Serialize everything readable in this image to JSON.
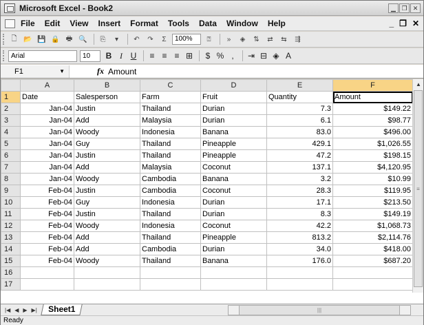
{
  "window": {
    "title": "Microsoft Excel - Book2"
  },
  "menu": [
    "File",
    "Edit",
    "View",
    "Insert",
    "Format",
    "Tools",
    "Data",
    "Window",
    "Help"
  ],
  "toolbar": {
    "zoom": "100%",
    "sum_label": "Σ"
  },
  "format_toolbar": {
    "font": "Arial",
    "size": "10",
    "currency": "$",
    "percent": "%"
  },
  "formula_bar": {
    "cell_ref": "F1",
    "fx": "fx",
    "value": "Amount"
  },
  "columns": [
    "A",
    "B",
    "C",
    "D",
    "E",
    "F"
  ],
  "header_row": [
    "Date",
    "Salesperson",
    "Farm",
    "Fruit",
    "Quantity",
    "Amount"
  ],
  "rows": [
    [
      "Jan-04",
      "Justin",
      "Thailand",
      "Durian",
      "7.3",
      "$149.22"
    ],
    [
      "Jan-04",
      "Add",
      "Malaysia",
      "Durian",
      "6.1",
      "$98.77"
    ],
    [
      "Jan-04",
      "Woody",
      "Indonesia",
      "Banana",
      "83.0",
      "$496.00"
    ],
    [
      "Jan-04",
      "Guy",
      "Thailand",
      "Pineapple",
      "429.1",
      "$1,026.55"
    ],
    [
      "Jan-04",
      "Justin",
      "Thailand",
      "Pineapple",
      "47.2",
      "$198.15"
    ],
    [
      "Jan-04",
      "Add",
      "Malaysia",
      "Coconut",
      "137.1",
      "$4,120.95"
    ],
    [
      "Jan-04",
      "Woody",
      "Cambodia",
      "Banana",
      "3.2",
      "$10.99"
    ],
    [
      "Feb-04",
      "Justin",
      "Cambodia",
      "Coconut",
      "28.3",
      "$119.95"
    ],
    [
      "Feb-04",
      "Guy",
      "Indonesia",
      "Durian",
      "17.1",
      "$213.50"
    ],
    [
      "Feb-04",
      "Justin",
      "Thailand",
      "Durian",
      "8.3",
      "$149.19"
    ],
    [
      "Feb-04",
      "Woody",
      "Indonesia",
      "Coconut",
      "42.2",
      "$1,068.73"
    ],
    [
      "Feb-04",
      "Add",
      "Thailand",
      "Pineapple",
      "813.2",
      "$2,114.76"
    ],
    [
      "Feb-04",
      "Add",
      "Cambodia",
      "Durian",
      "34.0",
      "$418.00"
    ],
    [
      "Feb-04",
      "Woody",
      "Thailand",
      "Banana",
      "176.0",
      "$687.20"
    ]
  ],
  "row_numbers": [
    "1",
    "2",
    "3",
    "4",
    "5",
    "6",
    "7",
    "8",
    "9",
    "10",
    "11",
    "12",
    "13",
    "14",
    "15",
    "16",
    "17"
  ],
  "sheet_tabs": [
    "Sheet1"
  ],
  "status": "Ready"
}
